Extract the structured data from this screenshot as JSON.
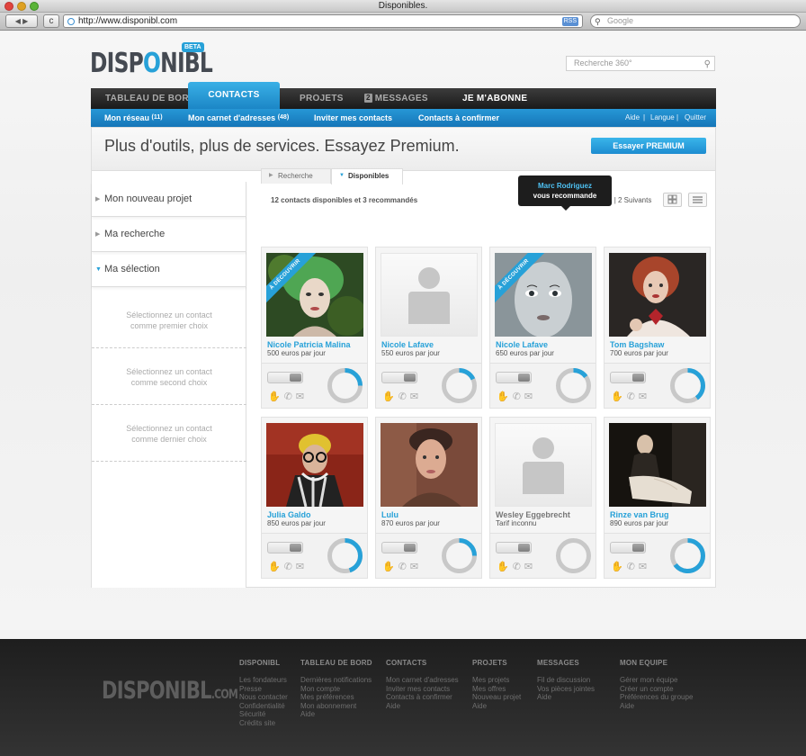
{
  "browser": {
    "window_title": "Disponibles.",
    "nav_arrows": "◀ ▶",
    "reload_glyph": "c",
    "url": "http://www.disponibl.com",
    "rss": "RSS",
    "search_placeholder": "Google"
  },
  "header": {
    "logo_prefix": "DISP",
    "logo_o": "O",
    "logo_suffix": "NIBL",
    "beta": "BETA",
    "search_placeholder": "Recherche 360°"
  },
  "main_nav": [
    {
      "label": "TABLEAU DE BORD"
    },
    {
      "label": "CONTACTS"
    },
    {
      "label": "PROJETS"
    },
    {
      "label": "MESSAGES",
      "badge": "2"
    },
    {
      "label": "JE M'ABONNE"
    }
  ],
  "sub_nav": [
    {
      "label": "Mon réseau",
      "count": "(11)"
    },
    {
      "label": "Mon carnet d'adresses",
      "count": "(48)"
    },
    {
      "label": "Inviter mes contacts",
      "count": ""
    },
    {
      "label": "Contacts à confirmer",
      "count": ""
    }
  ],
  "util_nav": [
    "Aide",
    "|",
    "Langue",
    "|",
    "Quitter"
  ],
  "promo": {
    "text": "Plus d'outils, plus de services. Essayez Premium.",
    "button": "Essayer PREMIUM"
  },
  "sidebar": {
    "items": [
      "Mon nouveau projet",
      "Ma recherche",
      "Ma sélection"
    ],
    "choices": [
      [
        "Sélectionnez un contact",
        "comme premier choix"
      ],
      [
        "Sélectionnez un contact",
        "comme second choix"
      ],
      [
        "Sélectionnez un contact",
        "comme dernier choix"
      ]
    ]
  },
  "tabs": [
    "Recherche",
    "Disponibles"
  ],
  "results": {
    "summary": "12 contacts disponibles et 3 recommandés",
    "pager_current": "1",
    "pager_sep": "|",
    "pager_next": "2 Suivants"
  },
  "tooltip": {
    "name": "Marc Rodriguez",
    "text": "vous recommande"
  },
  "ribbon_label": "À DÉCOUVRIR",
  "cards": [
    {
      "name": "Nicole Patricia Malina",
      "price": "500 euros par jour",
      "ribbon": true,
      "photo": "green-hair",
      "progress": 0.25
    },
    {
      "name": "Nicole Lafave",
      "price": "550 euros par jour",
      "ribbon": false,
      "photo": "placeholder",
      "progress": 0.18
    },
    {
      "name": "Nicole Lafave",
      "price": "650 euros par jour",
      "ribbon": true,
      "photo": "bw-face",
      "progress": 0.15
    },
    {
      "name": "Tom Bagshaw",
      "price": "700 euros par jour",
      "ribbon": false,
      "photo": "red-hair",
      "progress": 0.4
    },
    {
      "name": "Julia Galdo",
      "price": "850 euros par jour",
      "ribbon": false,
      "photo": "glasses",
      "progress": 0.45
    },
    {
      "name": "Lulu",
      "price": "870 euros par jour",
      "ribbon": false,
      "photo": "man-portrait",
      "progress": 0.25
    },
    {
      "name": "Wesley Eggebrecht",
      "price": "Tarif inconnu",
      "ribbon": false,
      "photo": "placeholder",
      "progress": 0,
      "muted": true
    },
    {
      "name": "Rinze van Brug",
      "price": "890 euros par jour",
      "ribbon": false,
      "photo": "dark-room",
      "progress": 0.65
    }
  ],
  "icons": [
    "hand-icon",
    "phone-icon",
    "mail-icon"
  ],
  "colors": {
    "accent": "#27a1d8",
    "ring_track": "#c8c8c8",
    "nav_dark": "#1a1a1a"
  },
  "footer": {
    "logo": "DISPONIBL",
    "logo_com": ".COM",
    "columns": [
      {
        "title": "DISPONIBL",
        "links": [
          "Les fondateurs",
          "Presse",
          "Nous contacter",
          "Confidentialité",
          "Sécurité",
          "Crédits site"
        ]
      },
      {
        "title": "TABLEAU DE BORD",
        "links": [
          "Dernières notifications",
          "Mon compte",
          "Mes préférences",
          "Mon abonnement",
          "Aide"
        ]
      },
      {
        "title": "CONTACTS",
        "links": [
          "Mon carnet d'adresses",
          "Inviter mes contacts",
          "Contacts à confirmer",
          "Aide"
        ]
      },
      {
        "title": "PROJETS",
        "links": [
          "Mes projets",
          "Mes offres",
          "Nouveau projet",
          "Aide"
        ]
      },
      {
        "title": "MESSAGES",
        "links": [
          "Fil de discussion",
          "Vos pièces jointes",
          "Aide"
        ]
      },
      {
        "title": "MON EQUIPE",
        "links": [
          "Gérer mon équipe",
          "Créer un compte",
          "Préférences du groupe",
          "Aide"
        ]
      }
    ]
  }
}
